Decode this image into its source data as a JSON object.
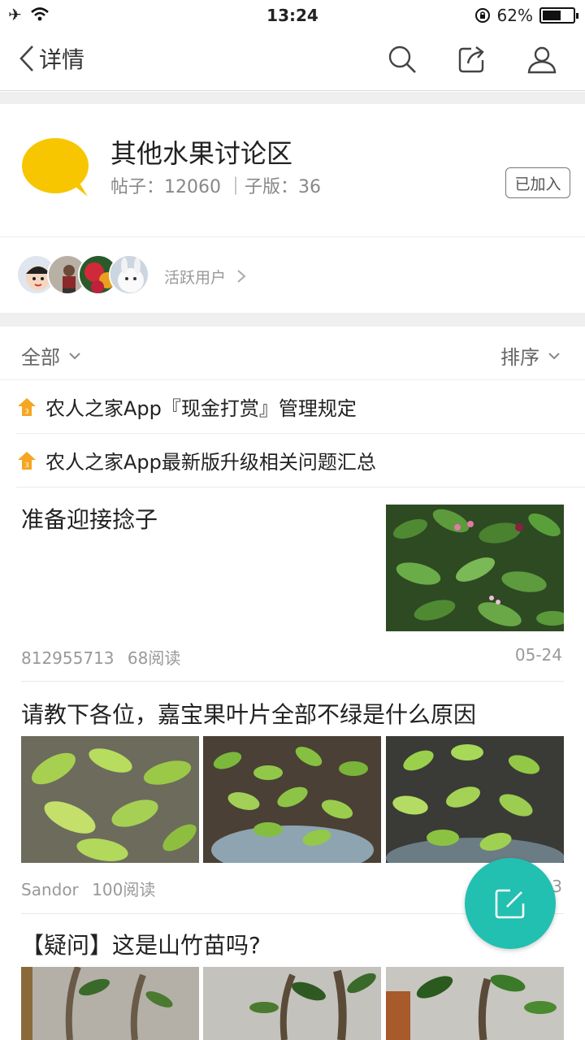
{
  "status_bar": {
    "time": "13:24",
    "battery": "62%",
    "battery_level": 0.62
  },
  "nav": {
    "back_label": "详情"
  },
  "forum": {
    "title": "其他水果讨论区",
    "stats": "帖子：12060 ｜子版：36",
    "joined_label": "已加入",
    "logo_color": "#f7c600"
  },
  "active_users": {
    "label": "活跃用户"
  },
  "filter": {
    "left_label": "全部",
    "right_label": "排序"
  },
  "pinned": [
    {
      "text": "农人之家App『现金打赏』管理规定"
    },
    {
      "text": "农人之家App最新版升级相关问题汇总"
    }
  ],
  "posts": [
    {
      "title": "准备迎接捻子",
      "author": "812955713",
      "reads": "68阅读",
      "date": "05-24"
    },
    {
      "title": "请教下各位，嘉宝果叶片全部不绿是什么原因",
      "author": "Sandor",
      "reads": "100阅读",
      "date": "3"
    },
    {
      "title": "【疑问】这是山竹苗吗?"
    }
  ],
  "colors": {
    "accent": "#22c0b0",
    "pin": "#f5a623"
  }
}
